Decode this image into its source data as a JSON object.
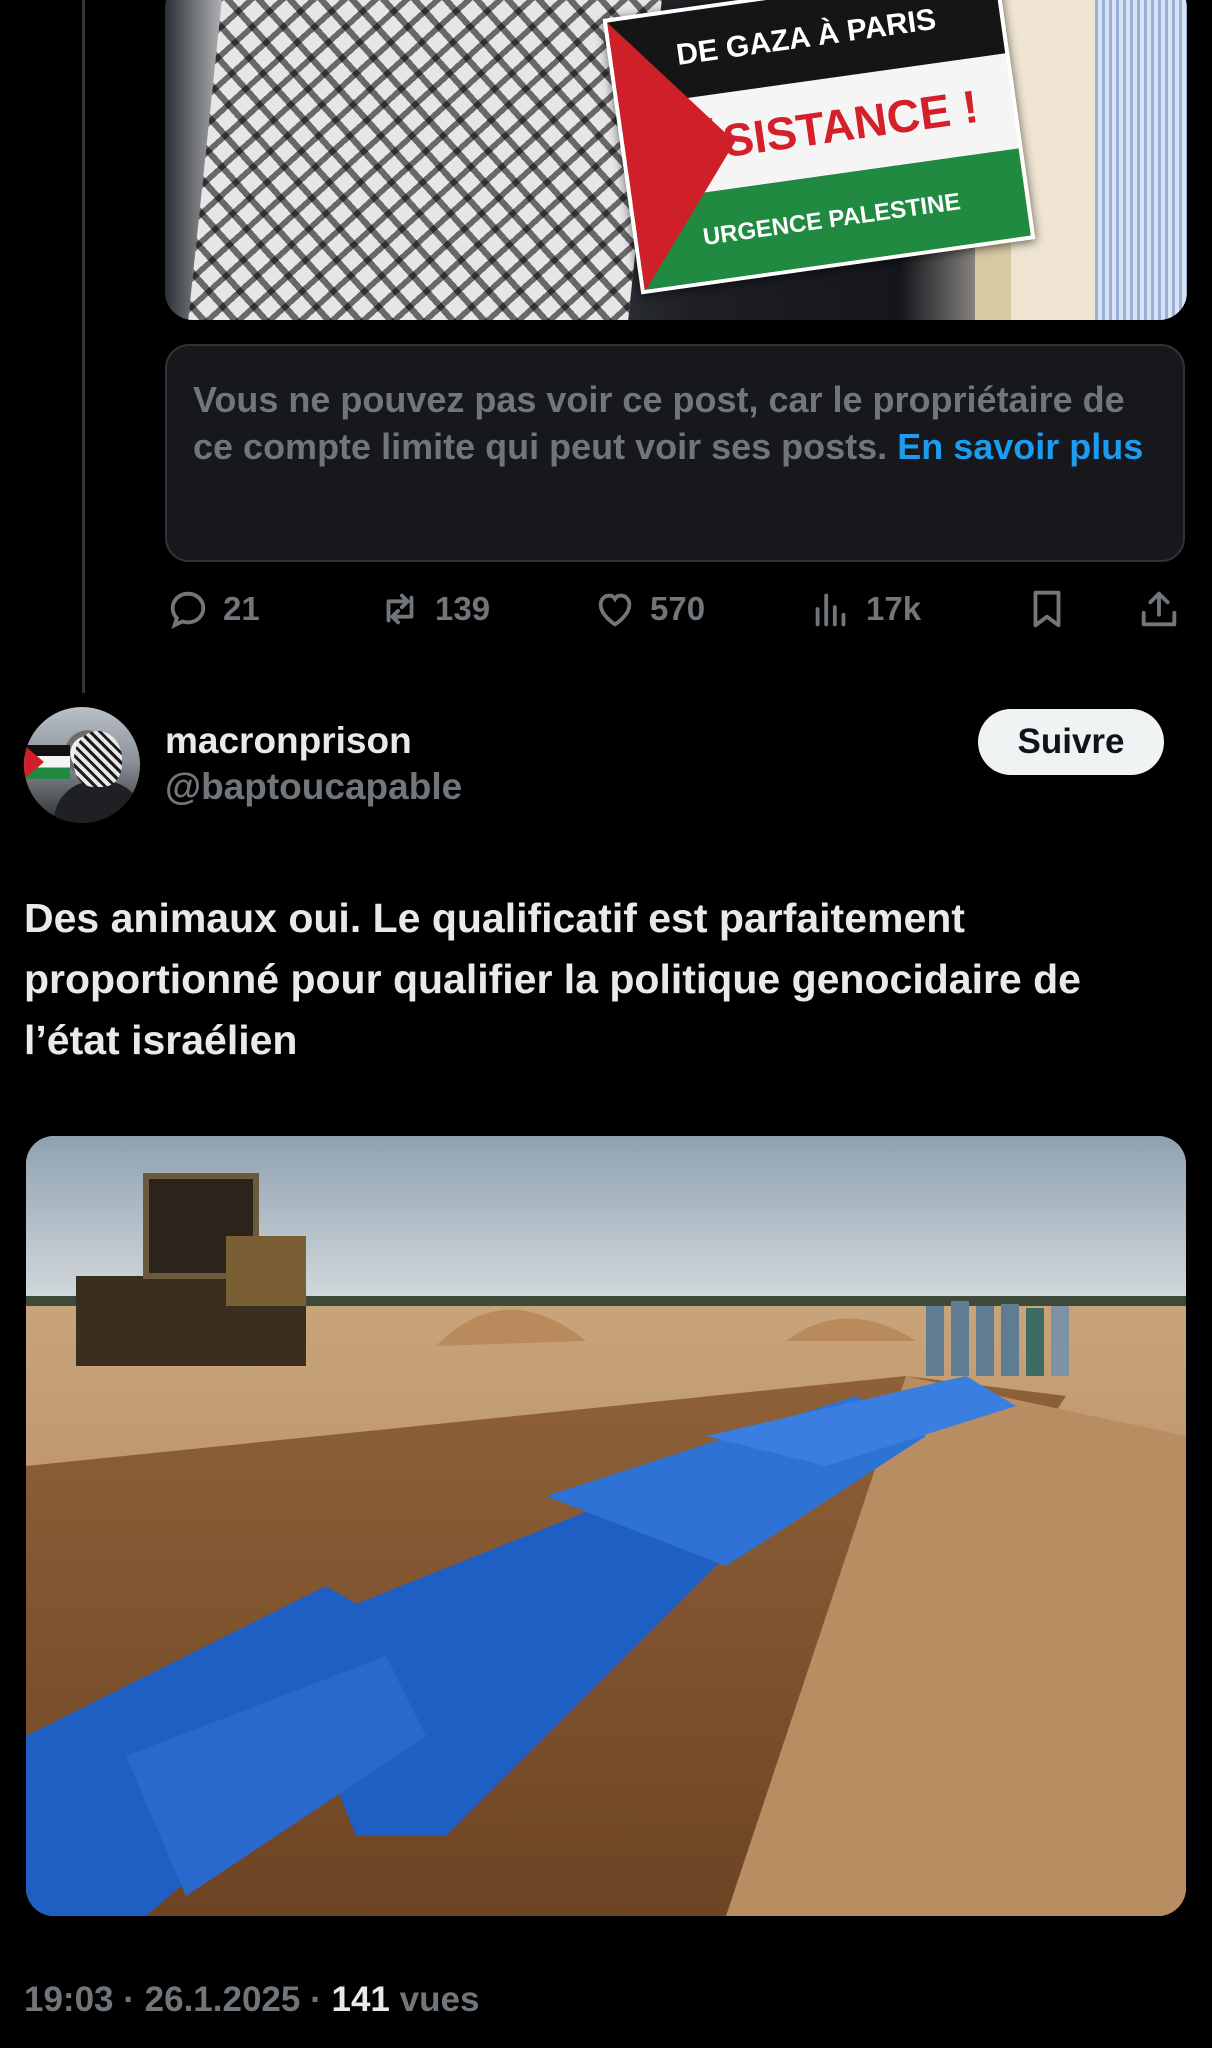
{
  "previous_post": {
    "sign_lines": [
      "DE GAZA À PARIS",
      "RÉSISTANCE !",
      "URGENCE PALESTINE"
    ],
    "restricted_notice": "Vous ne pouvez pas voir ce post, car le propriétaire de ce compte limite qui peut voir ses posts.",
    "learn_more": "En savoir plus",
    "actions": {
      "replies": "21",
      "reposts": "139",
      "likes": "570",
      "views": "17k"
    }
  },
  "post": {
    "author_name": "macronprison",
    "author_handle": "@baptoucapable",
    "follow_label": "Suivre",
    "text": "Des animaux oui. Le qualificatif est parfaitement proportionné pour qualifier la politique genocidaire de l’état israélien",
    "time": "19:03",
    "date": "26.1.2025",
    "views_count": "141",
    "views_label": "vues"
  },
  "colors": {
    "background": "#000000",
    "text_primary": "#e7e9ea",
    "text_secondary": "#71767b",
    "link": "#1d9bf0"
  },
  "icons": [
    "reply-icon",
    "repost-icon",
    "like-icon",
    "views-icon",
    "bookmark-icon",
    "share-icon"
  ]
}
